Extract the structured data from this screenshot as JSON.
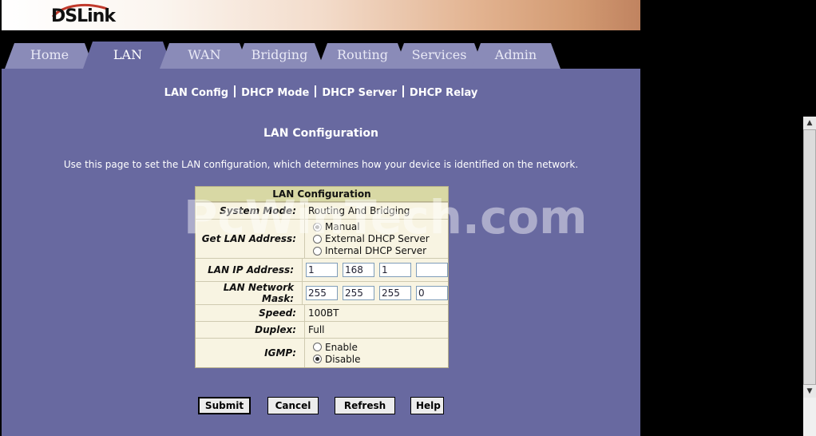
{
  "brand": {
    "logo_text": "DSLink"
  },
  "tabs": [
    {
      "label": "Home"
    },
    {
      "label": "LAN"
    },
    {
      "label": "WAN"
    },
    {
      "label": "Bridging"
    },
    {
      "label": "Routing"
    },
    {
      "label": "Services"
    },
    {
      "label": "Admin"
    }
  ],
  "active_tab": "LAN",
  "subnav": {
    "items": [
      {
        "label": "LAN Config"
      },
      {
        "label": "DHCP Mode"
      },
      {
        "label": "DHCP Server"
      },
      {
        "label": "DHCP Relay"
      }
    ]
  },
  "page": {
    "title": "LAN Configuration",
    "description": "Use this page to set the LAN configuration, which determines how your device is identified on the network."
  },
  "form": {
    "header": "LAN Configuration",
    "system_mode": {
      "label": "System Mode:",
      "value": "Routing And Bridging"
    },
    "get_lan_address": {
      "label": "Get LAN Address:",
      "options": [
        "Manual",
        "External DHCP Server",
        "Internal DHCP Server"
      ],
      "selected": "Manual"
    },
    "lan_ip": {
      "label": "LAN IP Address:",
      "octets": [
        "1",
        "168",
        "1",
        ""
      ]
    },
    "mask": {
      "label": "LAN Network Mask:",
      "octets": [
        "255",
        "255",
        "255",
        "0"
      ]
    },
    "speed": {
      "label": "Speed:",
      "value": "100BT"
    },
    "duplex": {
      "label": "Duplex:",
      "value": "Full"
    },
    "igmp": {
      "label": "IGMP:",
      "options": [
        "Enable",
        "Disable"
      ],
      "selected": "Disable"
    }
  },
  "buttons": {
    "submit": "Submit",
    "cancel": "Cancel",
    "refresh": "Refresh",
    "help": "Help"
  },
  "watermark": "PcWinTech.com"
}
